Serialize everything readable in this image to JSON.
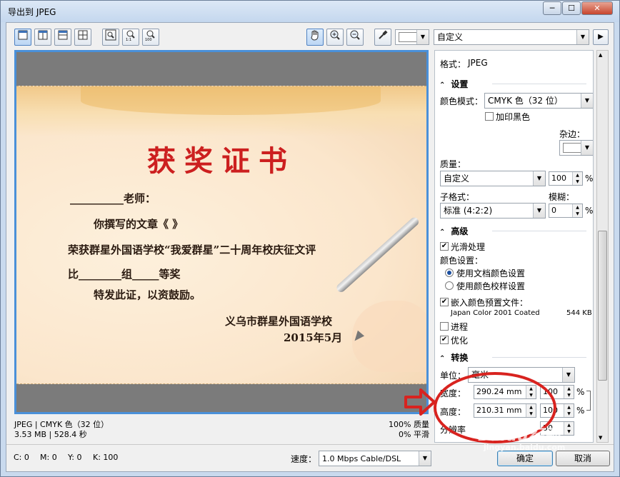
{
  "window": {
    "title": "导出到 JPEG",
    "min_glyph": "─",
    "max_glyph": "☐",
    "close_glyph": "✕"
  },
  "toolbar": {
    "view_buttons": [
      "single-view-icon",
      "split-vertical-icon",
      "split-horizontal-icon",
      "quad-view-icon"
    ],
    "zoom_buttons": [
      "zoom-fit-icon",
      "zoom-1to1-icon",
      "zoom-100-icon"
    ],
    "tools": [
      "hand-icon",
      "zoom-in-icon",
      "zoom-out-icon",
      "eyedropper-icon"
    ],
    "color_swatch": "#ffffff",
    "preset": "自定义",
    "preset_next_glyph": "▶"
  },
  "preview": {
    "certificate": {
      "title": "获奖证书",
      "lines": [
        "__________老师：",
        "你撰写的文章《                                                》",
        "荣获群星外国语学校“我爱群星”二十周年校庆征文评",
        "比________组_____等奖",
        "特发此证，以资鼓励。",
        "义乌市群星外国语学校",
        "2015年5月"
      ]
    },
    "info_left": [
      "JPEG  |  CMYK 色（32 位）",
      "3.53 MB  |  528.4 秒"
    ],
    "info_right": [
      "100% 质量",
      "0% 平滑"
    ]
  },
  "panel": {
    "format_label": "格式：",
    "format_value": "JPEG",
    "sections": {
      "settings": "设置",
      "advanced": "高级",
      "transform": "转换"
    },
    "color_mode_label": "颜色模式：",
    "color_mode_value": "CMYK 色（32 位）",
    "overprint_black": "加印黑色",
    "matte_label": "杂边：",
    "quality_label": "质量：",
    "quality_value": "自定义",
    "quality_percent": "100",
    "subformat_label": "子格式：",
    "subformat_value": "标准 (4:2:2)",
    "blur_label": "模糊：",
    "blur_value": "0",
    "percent_sign": "%",
    "antialias": "光滑处理",
    "color_settings_label": "颜色设置：",
    "use_doc_color": "使用文档颜色设置",
    "use_proof_color": "使用颜色校样设置",
    "embed_profile": "嵌入颜色预置文件：",
    "profile_name": "Japan Color 2001 Coated",
    "profile_size": "544 KB",
    "progressive": "进程",
    "optimize": "优化",
    "unit_label": "单位：",
    "unit_value": "毫米",
    "width_label": "宽度：",
    "width_value": "290.24 mm",
    "width_percent": "100",
    "height_label": "高度：",
    "height_value": "210.31 mm",
    "height_percent": "100",
    "resolution_label": "分辨率",
    "resolution_value": "50"
  },
  "statusbar": {
    "c": "C: 0",
    "m": "M: 0",
    "y": "Y: 0",
    "k": "K: 100",
    "speed_label": "速度：",
    "speed_value": "1.0 Mbps Cable/DSL",
    "ok": "确定",
    "cancel": "取消"
  },
  "watermark": {
    "logo_text": "Baidu经验",
    "url": "jingyan.baidu.com"
  },
  "colors": {
    "accent_blue": "#4a90d9",
    "annotation_red": "#d8231f",
    "cert_red": "#cc1f1f"
  }
}
